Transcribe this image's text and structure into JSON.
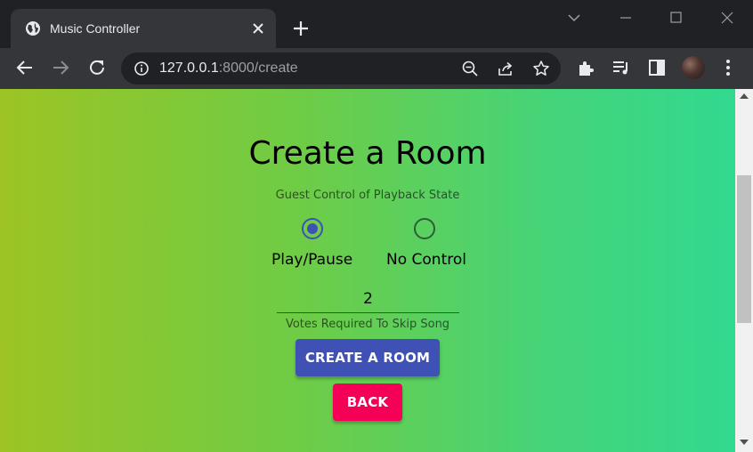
{
  "browser": {
    "tab_title": "Music Controller",
    "url_host": "127.0.0.1",
    "url_path": ":8000/create"
  },
  "page": {
    "title": "Create a Room",
    "guest_control_label": "Guest Control of Playback State",
    "options": [
      {
        "label": "Play/Pause",
        "selected": true
      },
      {
        "label": "No Control",
        "selected": false
      }
    ],
    "votes_value": "2",
    "votes_helper": "Votes Required To Skip Song",
    "create_button": "CREATE A ROOM",
    "back_button": "BACK"
  },
  "colors": {
    "primary": "#3f51b5",
    "secondary": "#f50057",
    "gradient_start": "#9dc424",
    "gradient_end": "#31d98f"
  },
  "icons": [
    "globe-icon",
    "close-icon",
    "plus-icon",
    "chevron-down-icon",
    "minimize-icon",
    "maximize-icon",
    "window-close-icon",
    "back-arrow-icon",
    "forward-arrow-icon",
    "reload-icon",
    "info-icon",
    "zoom-out-icon",
    "share-icon",
    "star-icon",
    "extensions-icon",
    "media-icon",
    "side-panel-icon",
    "more-icon"
  ]
}
